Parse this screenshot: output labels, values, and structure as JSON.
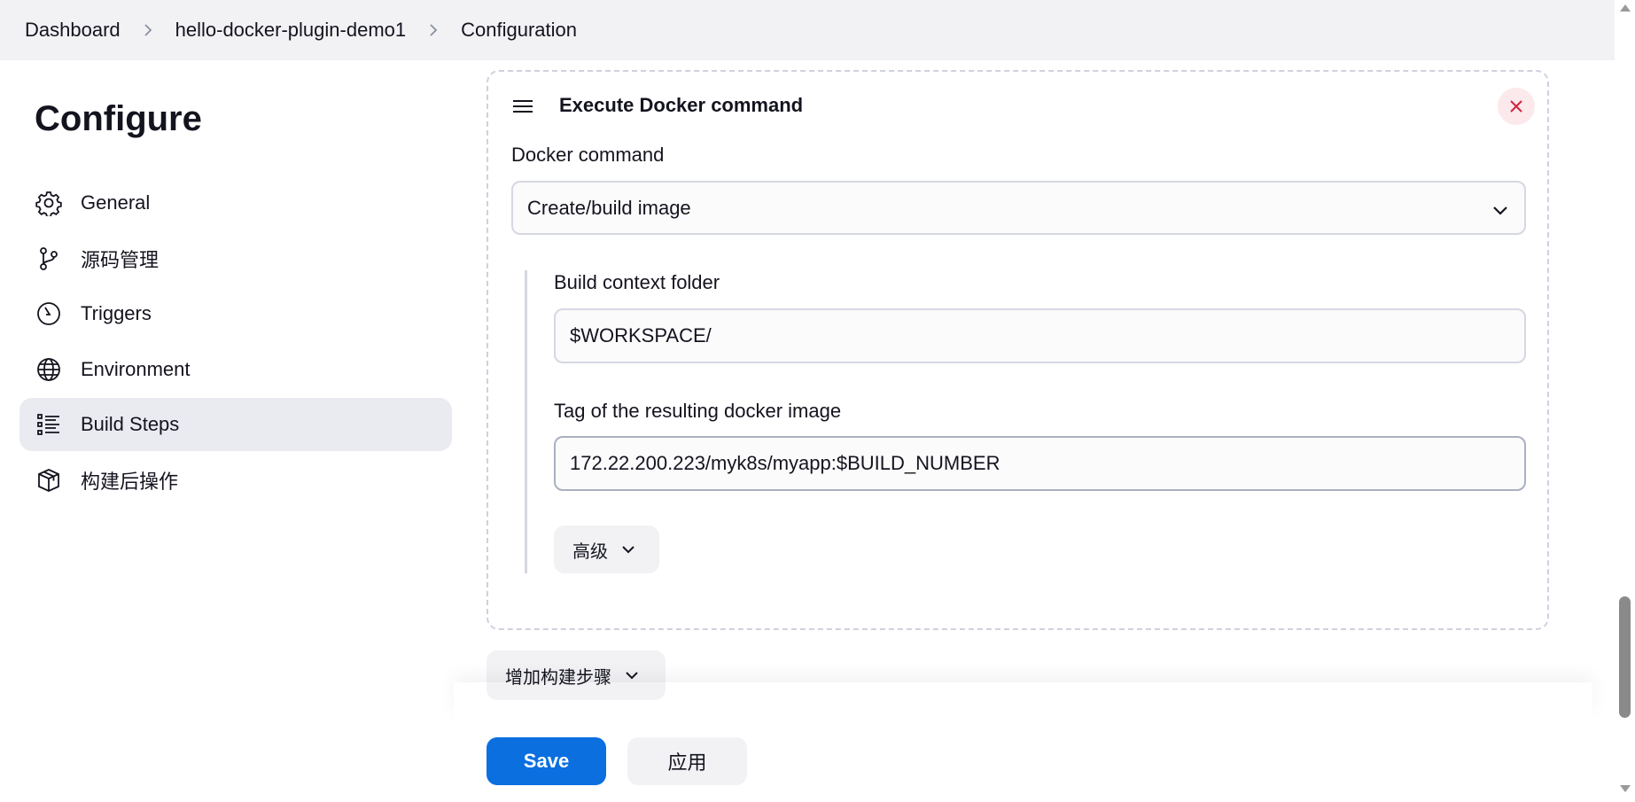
{
  "breadcrumb": {
    "items": [
      "Dashboard",
      "hello-docker-plugin-demo1",
      "Configuration"
    ]
  },
  "sidebar": {
    "title": "Configure",
    "items": [
      {
        "label": "General",
        "icon": "gear-icon"
      },
      {
        "label": "源码管理",
        "icon": "branch-icon"
      },
      {
        "label": "Triggers",
        "icon": "clock-icon"
      },
      {
        "label": "Environment",
        "icon": "globe-icon"
      },
      {
        "label": "Build Steps",
        "icon": "list-icon",
        "active": true
      },
      {
        "label": "构建后操作",
        "icon": "package-icon"
      }
    ]
  },
  "step": {
    "title": "Execute Docker command",
    "docker_command_label": "Docker command",
    "docker_command_value": "Create/build image",
    "build_context_label": "Build context folder",
    "build_context_value": "$WORKSPACE/",
    "tag_label": "Tag of the resulting docker image",
    "tag_value": "172.22.200.223/myk8s/myapp:$BUILD_NUMBER",
    "advanced_label": "高级"
  },
  "add_step_label": "增加构建步骤",
  "actions": {
    "save_label": "Save",
    "apply_label": "应用"
  },
  "colors": {
    "primary": "#0b6fe0",
    "close_bg": "#fbe9ec",
    "close_icon": "#d0243c"
  }
}
